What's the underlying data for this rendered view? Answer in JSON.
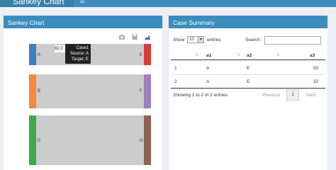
{
  "header": {
    "brand": "Sankey Chart",
    "menu_icon": "hamburger-icon"
  },
  "left_box": {
    "title": "Sankey Chart",
    "toolbar_icons": [
      "camera-icon",
      "save-icon",
      "plot-icon"
    ]
  },
  "sankey": {
    "nodes_left": [
      "A",
      "B",
      "C"
    ],
    "nodes_right": [
      "E",
      "F",
      "G"
    ],
    "colors": {
      "A": "#3d7fc1",
      "B": "#f5883a",
      "C": "#3daa4b",
      "E": "#d83b3b",
      "F": "#9c7ec1",
      "G": "#8f6055",
      "link": "#cccccc"
    },
    "tooltip": {
      "value": "82.0",
      "line1": "Case1",
      "line2": "Source: A",
      "line3": "Target: E"
    }
  },
  "right_box": {
    "title": "Case Summary",
    "show_label": "Show",
    "entries_value": "10",
    "entries_label": "entries",
    "search_label": "Search:",
    "columns": [
      "",
      "a1",
      "a2",
      "a3"
    ],
    "rows": [
      [
        "1",
        "A",
        "E",
        "50"
      ],
      [
        "2",
        "A",
        "E",
        "32"
      ]
    ],
    "info": "Showing 1 to 2 of 2 entries",
    "previous": "Previous",
    "page": "1",
    "next": "Next"
  }
}
